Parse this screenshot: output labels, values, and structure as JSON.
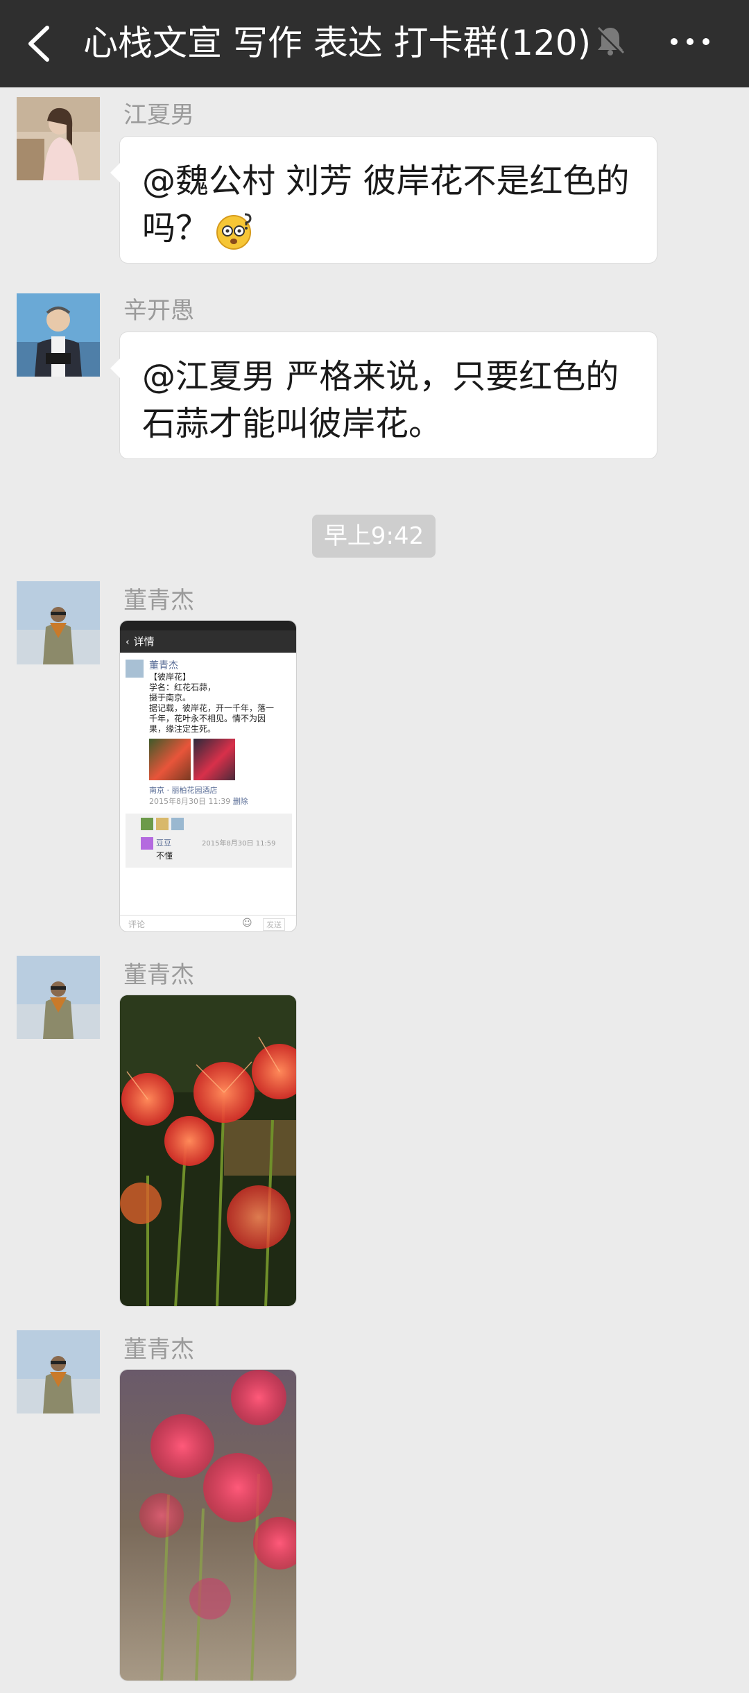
{
  "header": {
    "title": "心栈文宣 写作 表达 打卡群(120)",
    "back_icon": "chevron-left-icon",
    "mute_icon": "bell-muted-icon",
    "more_icon": "more-dots-icon"
  },
  "messages": [
    {
      "sender": "江夏男",
      "text": "@魏公村 刘芳  彼岸花不是红色的吗？",
      "emoji": "dizzy-face-emoji"
    },
    {
      "sender": "辛开愚",
      "text": "@江夏男  严格来说，只要红色的石蒜才能叫彼岸花。"
    },
    {
      "timestamp": "早上9:42"
    },
    {
      "sender": "董青杰",
      "type": "image",
      "screenshot": {
        "header": "详情",
        "author": "董青杰",
        "lines": [
          "【彼岸花】",
          "学名：红花石蒜，",
          "摄于南京。",
          "据记载，彼岸花，开一千年，落一",
          "千年，花叶永不相见。情不为因",
          "果，缘注定生死。"
        ],
        "location": "南京 · 丽柏花园酒店",
        "time": "2015年8月30日 11:39",
        "delete": "删除",
        "comment_author": "豆豆",
        "comment_time": "2015年8月30日 11:59",
        "comment_text": "不懂",
        "comment_placeholder": "评论",
        "send_label": "发送"
      }
    },
    {
      "sender": "董青杰",
      "type": "image"
    },
    {
      "sender": "董青杰",
      "type": "image"
    }
  ],
  "colors": {
    "topbar": "#2f2f2f",
    "background": "#ebebeb",
    "bubble": "#ffffff",
    "nickname": "#9a9a9a"
  }
}
